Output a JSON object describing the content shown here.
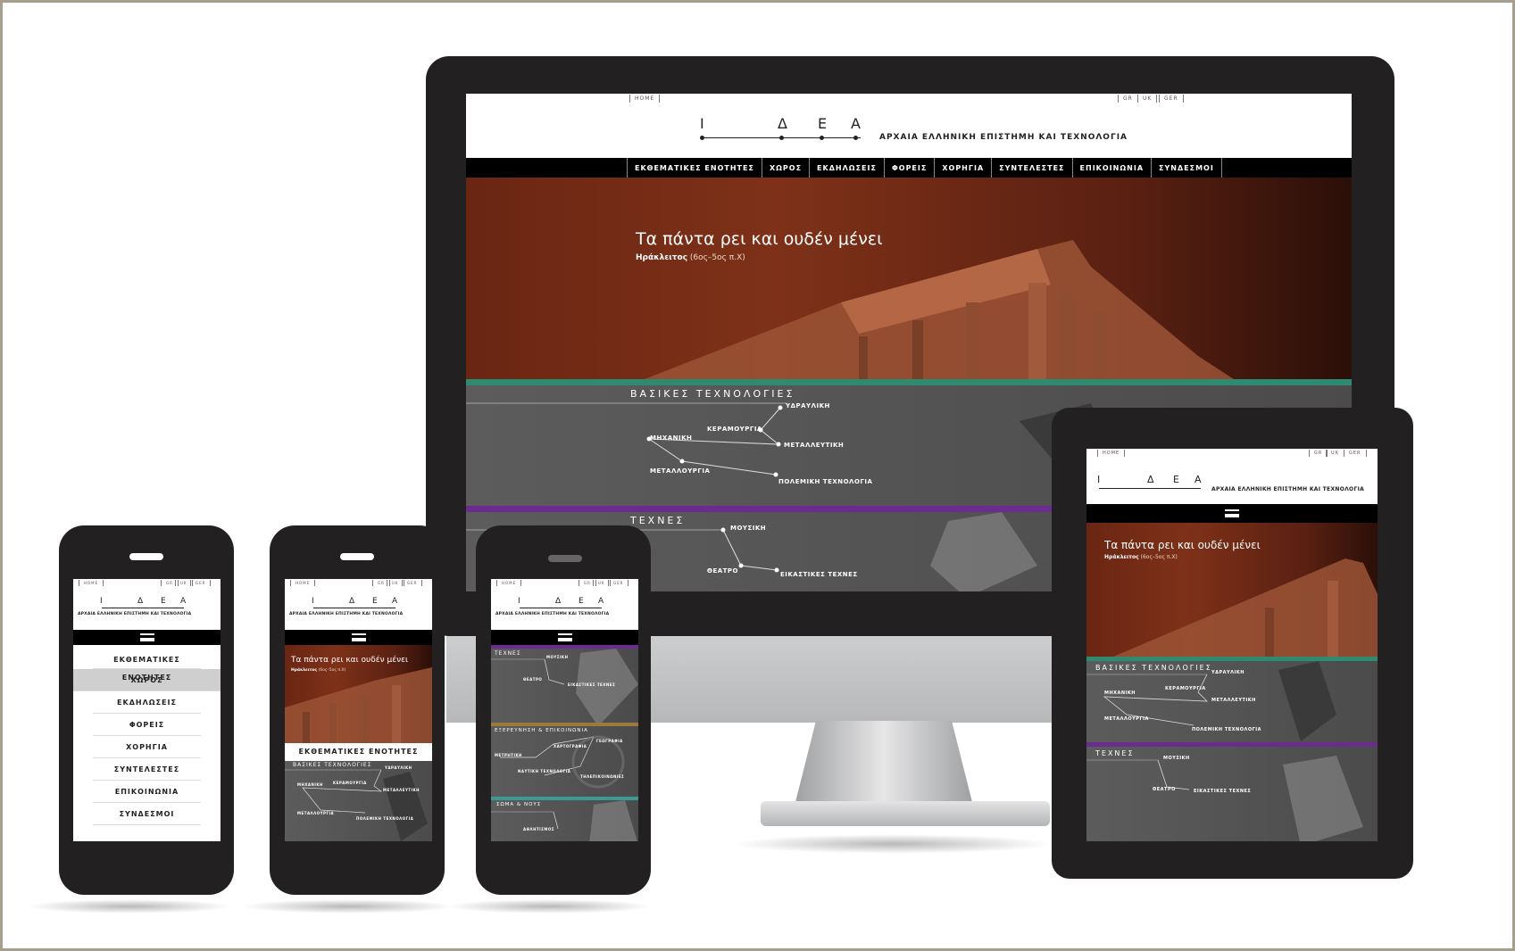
{
  "site": {
    "top_links": {
      "home": "HOME",
      "gr": "GR",
      "uk": "UK",
      "ger": "GER"
    },
    "logo_letters": [
      "Ι",
      "Δ",
      "Ε",
      "Α"
    ],
    "subtitle": "ΑΡΧΑΙΑ ΕΛΛΗΝΙΚΗ ΕΠΙΣΤΗΜΗ ΚΑΙ ΤΕΧΝΟΛΟΓΙΑ",
    "nav": [
      "ΕΚΘΕΜΑΤΙΚΕΣ ΕΝΟΤΗΤΕΣ",
      "ΧΩΡΟΣ",
      "ΕΚΔΗΛΩΣΕΙΣ",
      "ΦΟΡΕΙΣ",
      "ΧΟΡΗΓΙΑ",
      "ΣΥΝΤΕΛΕΣΤΕΣ",
      "ΕΠΙΚΟΙΝΩΝΙΑ",
      "ΣΥΝΔΕΣΜΟΙ"
    ],
    "hero": {
      "quote": "Τα πάντα ρει και ουδέν μένει",
      "author": "Ηράκλειτος",
      "dates": "(6ος–5ος π.Χ)"
    },
    "sections": {
      "tech": {
        "title": "ΒΑΣΙΚΕΣ ΤΕΧΝΟΛΟΓΙΕΣ",
        "nodes": [
          "ΥΔΡΑΥΛΙΚΗ",
          "ΚΕΡΑΜΟΥΡΓΙΑ",
          "ΜΗΧΑΝΙΚΗ",
          "ΜΕΤΑΛΛΕΥΤΙΚΗ",
          "ΜΕΤΑΛΛΟΥΡΓΙΑ",
          "ΠΟΛΕΜΙΚΗ ΤΕΧΝΟΛΟΓΙΑ"
        ],
        "color": "#2f8a72"
      },
      "arts": {
        "title": "ΤΕΧΝΕΣ",
        "nodes": [
          "ΜΟΥΣΙΚΗ",
          "ΘΕΑΤΡΟ",
          "ΕΙΚΑΣΤΙΚΕΣ ΤΕΧΝΕΣ"
        ],
        "color": "#6a2c8f"
      },
      "explore": {
        "title": "ΕΞΕΡΕΥΝΗΣΗ & ΕΠΙΚΟΙΝΩΝΙΑ",
        "nodes": [
          "ΜΕΤΡΗΤΙΚΗ",
          "ΧΑΡΤΟΓΡΑΦΙΑ",
          "ΓΕΩΓΡΑΦΙΑ",
          "ΝΑΥΤΙΚΗ ΤΕΧΝΟΛΟΓΙΑ",
          "ΤΗΛΕΠΙΚΟΙΝΩΝΙΕΣ"
        ],
        "color": "#9c7a3c"
      },
      "body": {
        "title": "ΣΩΜΑ & ΝΟΥΣ",
        "nodes": [
          "ΑΘΛΗΤΙΣΜΟΣ"
        ],
        "color": "#3a9a94"
      }
    },
    "mobile_section_header": "ΕΚΘΕΜΑΤΙΚΕΣ ΕΝΟΤΗΤΕΣ",
    "mobile_menu_active": "ΧΩΡΟΣ"
  },
  "colors": {
    "frame_border": "#a79f8d",
    "device_body": "#232021",
    "hero_dark": "#6a2613",
    "section_grey": "#555555",
    "tech_green": "#2f8a72",
    "arts_purple": "#6a2c8f"
  },
  "icons": {
    "menu": "hamburger-menu-icon"
  }
}
